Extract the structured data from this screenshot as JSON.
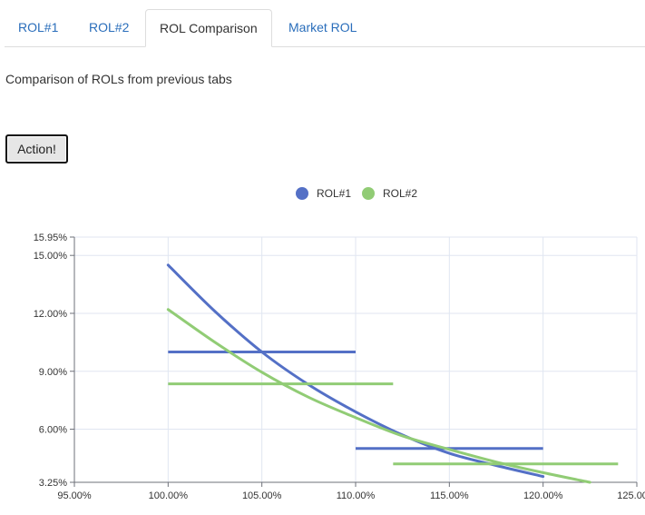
{
  "tabs": [
    {
      "label": "ROL#1",
      "active": false
    },
    {
      "label": "ROL#2",
      "active": false
    },
    {
      "label": "ROL Comparison",
      "active": true
    },
    {
      "label": "Market ROL",
      "active": false
    }
  ],
  "description": "Comparison of ROLs from previous tabs",
  "action_button": {
    "label": "Action!"
  },
  "colors": {
    "rol1": "#5470c6",
    "rol2": "#91cc75",
    "link": "#2a6ebb"
  },
  "chart_data": {
    "type": "line",
    "xlim": [
      0.95,
      1.25
    ],
    "ylim": [
      0.0325,
      0.1595
    ],
    "x_ticks": [
      "95.00%",
      "100.00%",
      "105.00%",
      "110.00%",
      "115.00%",
      "120.00%",
      "125.00%"
    ],
    "y_ticks": [
      "3.25%",
      "6.00%",
      "9.00%",
      "12.00%",
      "15.00%",
      "15.95%"
    ],
    "grid": true,
    "legend_position": "top-center",
    "series": [
      {
        "name": "ROL#1",
        "color": "#5470c6",
        "curve": [
          [
            1.0,
            0.145
          ],
          [
            1.025,
            0.121
          ],
          [
            1.05,
            0.1
          ],
          [
            1.075,
            0.083
          ],
          [
            1.1,
            0.069
          ],
          [
            1.125,
            0.057
          ],
          [
            1.15,
            0.0475
          ],
          [
            1.175,
            0.0412
          ],
          [
            1.2,
            0.0355
          ]
        ],
        "segments": [
          [
            [
              1.0,
              0.1
            ],
            [
              1.1,
              0.1
            ]
          ],
          [
            [
              1.1,
              0.05
            ],
            [
              1.2,
              0.05
            ]
          ]
        ]
      },
      {
        "name": "ROL#2",
        "color": "#91cc75",
        "curve": [
          [
            1.0,
            0.122
          ],
          [
            1.025,
            0.105
          ],
          [
            1.05,
            0.0895
          ],
          [
            1.075,
            0.0765
          ],
          [
            1.1,
            0.066
          ],
          [
            1.125,
            0.0565
          ],
          [
            1.15,
            0.0495
          ],
          [
            1.175,
            0.043
          ],
          [
            1.2,
            0.0375
          ],
          [
            1.225,
            0.0325
          ]
        ],
        "segments": [
          [
            [
              1.0,
              0.0835
            ],
            [
              1.12,
              0.0835
            ]
          ],
          [
            [
              1.12,
              0.042
            ],
            [
              1.24,
              0.042
            ]
          ]
        ]
      }
    ]
  }
}
